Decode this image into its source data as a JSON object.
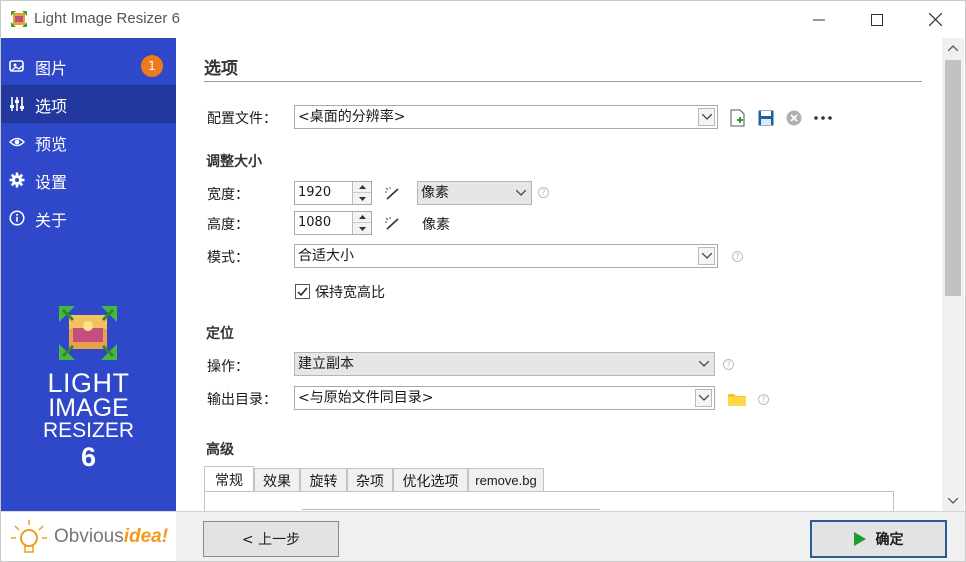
{
  "window": {
    "title": "Light Image Resizer 6"
  },
  "sidebar": {
    "items": [
      {
        "label": "图片",
        "icon": "photos-icon",
        "badge": "1"
      },
      {
        "label": "选项",
        "icon": "sliders-icon"
      },
      {
        "label": "预览",
        "icon": "eye-icon"
      },
      {
        "label": "设置",
        "icon": "gear-icon"
      },
      {
        "label": "关于",
        "icon": "info-icon"
      }
    ],
    "logo": {
      "line1": "LIGHT",
      "line2": "IMAGE",
      "line3": "RESIZER",
      "line4": "6"
    },
    "brand": {
      "part1": "Obvious",
      "part2": "idea!"
    }
  },
  "options": {
    "title": "选项",
    "profile": {
      "label": "配置文件：",
      "value": "<桌面的分辨率>"
    },
    "resize": {
      "heading": "调整大小",
      "width_label": "宽度：",
      "width_value": "1920",
      "unit_value": "像素",
      "height_label": "高度：",
      "height_value": "1080",
      "height_unit": "像素",
      "mode_label": "模式：",
      "mode_value": "合适大小",
      "keep_ratio_label": "保持宽高比",
      "keep_ratio_checked": true
    },
    "location": {
      "heading": "定位",
      "action_label": "操作：",
      "action_value": "建立副本",
      "output_label": "输出目录：",
      "output_value": "<与原始文件同目录>"
    },
    "advanced": {
      "heading": "高级",
      "tabs": [
        "常规",
        "效果",
        "旋转",
        "杂项",
        "优化选项",
        "remove.bg"
      ]
    }
  },
  "footer": {
    "back_label": "< 上一步",
    "ok_label": "确定"
  },
  "colors": {
    "sidebar": "#2f47c9",
    "sidebar_active": "#23389e",
    "badge": "#f07a1a",
    "ok_play": "#1e9c2e"
  }
}
